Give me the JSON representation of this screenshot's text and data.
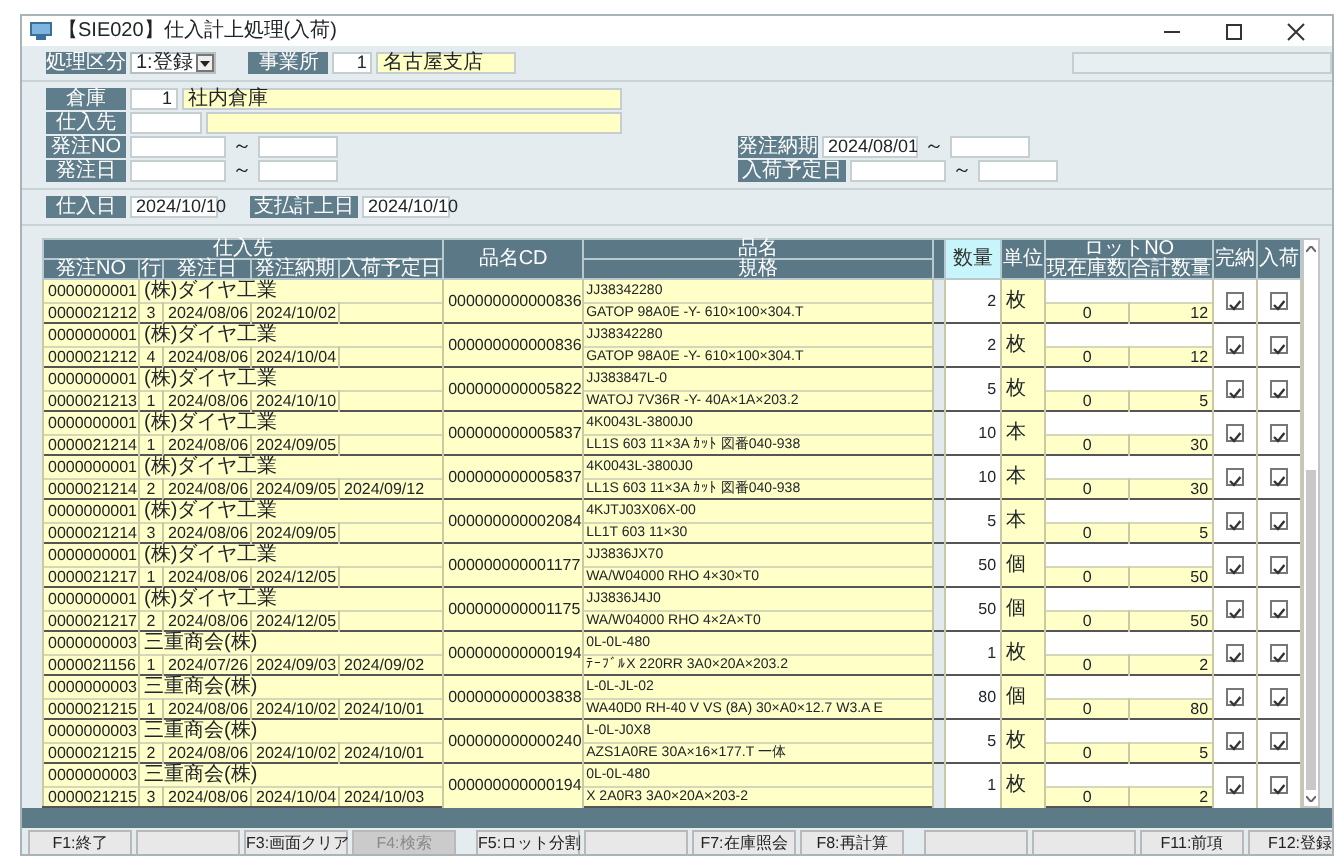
{
  "window": {
    "title": "【SIE020】仕入計上処理(入荷)"
  },
  "top_bar": {
    "mode": {
      "label": "処理区分",
      "value": "1:登録"
    },
    "office": {
      "label": "事業所",
      "code": "1",
      "name": "名古屋支店"
    }
  },
  "filters": {
    "warehouse": {
      "label": "倉庫",
      "code": "1",
      "name": "社内倉庫"
    },
    "supplier": {
      "label": "仕入先"
    },
    "order_no": {
      "label": "発注NO",
      "separator": "～"
    },
    "order_date": {
      "label": "発注日",
      "separator": "～"
    },
    "due_date": {
      "label": "発注納期",
      "from": "2024/08/01",
      "separator": "～"
    },
    "arrival_date": {
      "label": "入荷予定日",
      "separator": "～"
    }
  },
  "dates": [
    {
      "label": "仕入日",
      "value": "2024/10/10"
    },
    {
      "label": "支払計上日",
      "value": "2024/10/10"
    }
  ],
  "table": {
    "headers": {
      "supplier": "仕入先",
      "order_no": "発注NO",
      "line": "行",
      "order_date": "発注日",
      "due_date": "発注納期",
      "arrival_date": "入荷予定日",
      "item_code": "品名CD",
      "item_name": "品名",
      "spec": "規格",
      "quantity": "数量",
      "unit": "単位",
      "lot_no": "ロットNO",
      "stock": "現在庫数",
      "total": "合計数量",
      "completed": "完納",
      "received": "入荷"
    },
    "rows": [
      {
        "supplier_code": "0000000001",
        "supplier_name": "(株)ダイヤ工業",
        "order_no": "0000021212",
        "line": "3",
        "order_date": "2024/08/06",
        "due_date": "2024/10/02",
        "item_code": "000000000000836",
        "item_name": "JJ38342280",
        "spec": "GATOP 98A0E -Y- 610×100×304.T",
        "quantity": "2",
        "unit": "枚",
        "stock": "0",
        "total": "12",
        "completed": true,
        "received": true
      },
      {
        "supplier_code": "0000000001",
        "supplier_name": "(株)ダイヤ工業",
        "order_no": "0000021212",
        "line": "4",
        "order_date": "2024/08/06",
        "due_date": "2024/10/04",
        "item_code": "000000000000836",
        "item_name": "JJ38342280",
        "spec": "GATOP 98A0E -Y- 610×100×304.T",
        "quantity": "2",
        "unit": "枚",
        "stock": "0",
        "total": "12",
        "completed": true,
        "received": true
      },
      {
        "supplier_code": "0000000001",
        "supplier_name": "(株)ダイヤ工業",
        "order_no": "0000021213",
        "line": "1",
        "order_date": "2024/08/06",
        "due_date": "2024/10/10",
        "item_code": "000000000005822",
        "item_name": "JJ383847L-0",
        "spec": "WATOJ 7V36R -Y- 40A×1A×203.2",
        "quantity": "5",
        "unit": "枚",
        "stock": "0",
        "total": "5",
        "completed": true,
        "received": true
      },
      {
        "supplier_code": "0000000001",
        "supplier_name": "(株)ダイヤ工業",
        "order_no": "0000021214",
        "line": "1",
        "order_date": "2024/08/06",
        "due_date": "2024/09/05",
        "item_code": "000000000005837",
        "item_name": "4K0043L-3800J0",
        "spec": "LL1S 603 11×3A ｶｯﾄ 図番040-938",
        "quantity": "10",
        "unit": "本",
        "stock": "0",
        "total": "30",
        "completed": true,
        "received": true
      },
      {
        "supplier_code": "0000000001",
        "supplier_name": "(株)ダイヤ工業",
        "order_no": "0000021214",
        "line": "2",
        "order_date": "2024/08/06",
        "due_date": "2024/09/05",
        "arrival_date": "2024/09/12",
        "item_code": "000000000005837",
        "item_name": "4K0043L-3800J0",
        "spec": "LL1S 603 11×3A ｶｯﾄ 図番040-938",
        "quantity": "10",
        "unit": "本",
        "stock": "0",
        "total": "30",
        "completed": true,
        "received": true
      },
      {
        "supplier_code": "0000000001",
        "supplier_name": "(株)ダイヤ工業",
        "order_no": "0000021214",
        "line": "3",
        "order_date": "2024/08/06",
        "due_date": "2024/09/05",
        "item_code": "000000000002084",
        "item_name": "4KJTJ03X06X-00",
        "spec": "LL1T 603 11×30",
        "quantity": "5",
        "unit": "本",
        "stock": "0",
        "total": "5",
        "completed": true,
        "received": true
      },
      {
        "supplier_code": "0000000001",
        "supplier_name": "(株)ダイヤ工業",
        "order_no": "0000021217",
        "line": "1",
        "order_date": "2024/08/06",
        "due_date": "2024/12/05",
        "item_code": "000000000001177",
        "item_name": "JJ3836JX70",
        "spec": "WA/W04000 RHO 4×30×T0",
        "quantity": "50",
        "unit": "個",
        "stock": "0",
        "total": "50",
        "completed": true,
        "received": true
      },
      {
        "supplier_code": "0000000001",
        "supplier_name": "(株)ダイヤ工業",
        "order_no": "0000021217",
        "line": "2",
        "order_date": "2024/08/06",
        "due_date": "2024/12/05",
        "item_code": "000000000001175",
        "item_name": "JJ3836J4J0",
        "spec": "WA/W04000 RHO 4×2A×T0",
        "quantity": "50",
        "unit": "個",
        "stock": "0",
        "total": "50",
        "completed": true,
        "received": true
      },
      {
        "supplier_code": "0000000003",
        "supplier_name": "三重商会(株)",
        "order_no": "0000021156",
        "line": "1",
        "order_date": "2024/07/26",
        "due_date": "2024/09/03",
        "arrival_date": "2024/09/02",
        "item_code": "000000000000194",
        "item_name": "0L-0L-480",
        "spec": "ﾃｰﾌﾞﾙX 220RR 3A0×20A×203.2",
        "quantity": "1",
        "unit": "枚",
        "stock": "0",
        "total": "2",
        "completed": true,
        "received": true
      },
      {
        "supplier_code": "0000000003",
        "supplier_name": "三重商会(株)",
        "order_no": "0000021215",
        "line": "1",
        "order_date": "2024/08/06",
        "due_date": "2024/10/02",
        "arrival_date": "2024/10/01",
        "item_code": "000000000003838",
        "item_name": "L-0L-JL-02",
        "spec": "WA40D0 RH-40 V VS (8A) 30×A0×12.7 W3.A E",
        "quantity": "80",
        "unit": "個",
        "stock": "0",
        "total": "80",
        "completed": true,
        "received": true
      },
      {
        "supplier_code": "0000000003",
        "supplier_name": "三重商会(株)",
        "order_no": "0000021215",
        "line": "2",
        "order_date": "2024/08/06",
        "due_date": "2024/10/02",
        "arrival_date": "2024/10/01",
        "item_code": "000000000000240",
        "item_name": "L-0L-J0X8",
        "spec": "AZS1A0RE 30A×16×177.T 一体",
        "quantity": "5",
        "unit": "枚",
        "stock": "0",
        "total": "5",
        "completed": true,
        "received": true
      },
      {
        "supplier_code": "0000000003",
        "supplier_name": "三重商会(株)",
        "order_no": "0000021215",
        "line": "3",
        "order_date": "2024/08/06",
        "due_date": "2024/10/04",
        "arrival_date": "2024/10/03",
        "item_code": "000000000000194",
        "item_name": "0L-0L-480",
        "spec": "X 2A0R3 3A0×20A×203-2",
        "quantity": "1",
        "unit": "枚",
        "stock": "0",
        "total": "2",
        "completed": true,
        "received": true
      }
    ]
  },
  "function_keys": [
    {
      "kind": "key",
      "label": "F1:終了",
      "disabled": false
    },
    {
      "kind": "blank"
    },
    {
      "kind": "key",
      "label": "F3:画面クリア",
      "disabled": false
    },
    {
      "kind": "key",
      "label": "F4:検索",
      "disabled": true
    },
    {
      "kind": "key",
      "label": "F5:ロット分割",
      "disabled": false
    },
    {
      "kind": "blank"
    },
    {
      "kind": "key",
      "label": "F7:在庫照会",
      "disabled": false
    },
    {
      "kind": "key",
      "label": "F8:再計算",
      "disabled": false
    },
    {
      "kind": "blank"
    },
    {
      "kind": "blank"
    },
    {
      "kind": "key",
      "label": "F11:前項",
      "disabled": false
    },
    {
      "kind": "key",
      "label": "F12:登録",
      "disabled": false
    }
  ]
}
